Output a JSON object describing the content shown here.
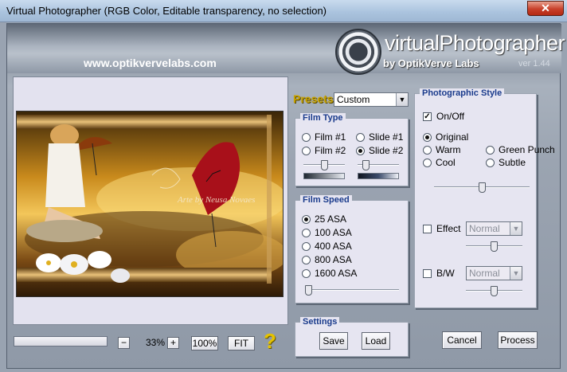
{
  "window": {
    "title": "Virtual Photographer (RGB Color, Editable transparency, no selection)",
    "close_label": "✕"
  },
  "header": {
    "url": "www.optikvervelabs.com",
    "logo_title": "virtualPhotographer",
    "logo_sub": "by OptikVerve Labs",
    "version": "ver 1.44"
  },
  "preview": {
    "watermark": "Arte by Neusa Novaes",
    "zoom": {
      "minus": "−",
      "value": "33%",
      "plus": "+",
      "percent100": "100%",
      "fit": "FIT"
    },
    "help": "?"
  },
  "presets": {
    "label": "Presets",
    "selected": "Custom"
  },
  "film_type": {
    "title": "Film Type",
    "options": [
      {
        "label": "Film #1",
        "checked": false
      },
      {
        "label": "Slide #1",
        "checked": false
      },
      {
        "label": "Film #2",
        "checked": false
      },
      {
        "label": "Slide #2",
        "checked": true
      }
    ]
  },
  "film_speed": {
    "title": "Film Speed",
    "options": [
      {
        "label": "25 ASA",
        "checked": true
      },
      {
        "label": "100 ASA",
        "checked": false
      },
      {
        "label": "400 ASA",
        "checked": false
      },
      {
        "label": "800 ASA",
        "checked": false
      },
      {
        "label": "1600 ASA",
        "checked": false
      }
    ]
  },
  "settings": {
    "title": "Settings",
    "save": "Save",
    "load": "Load"
  },
  "photographic_style": {
    "title": "Photographic Style",
    "onoff": {
      "label": "On/Off",
      "checked": true
    },
    "styles": [
      {
        "label": "Original",
        "checked": true
      },
      {
        "label": "Warm",
        "checked": false
      },
      {
        "label": "Green Punch",
        "checked": false
      },
      {
        "label": "Cool",
        "checked": false
      },
      {
        "label": "Subtle",
        "checked": false
      }
    ],
    "effect": {
      "label": "Effect",
      "checked": false,
      "mode": "Normal"
    },
    "bw": {
      "label": "B/W",
      "checked": false,
      "mode": "Normal"
    }
  },
  "actions": {
    "cancel": "Cancel",
    "process": "Process"
  },
  "colors": {
    "group_title": "#1a3b8c",
    "presets_label": "#c8a300",
    "close_button": "#c8402a",
    "panel_bg": "#e3e2ef"
  }
}
